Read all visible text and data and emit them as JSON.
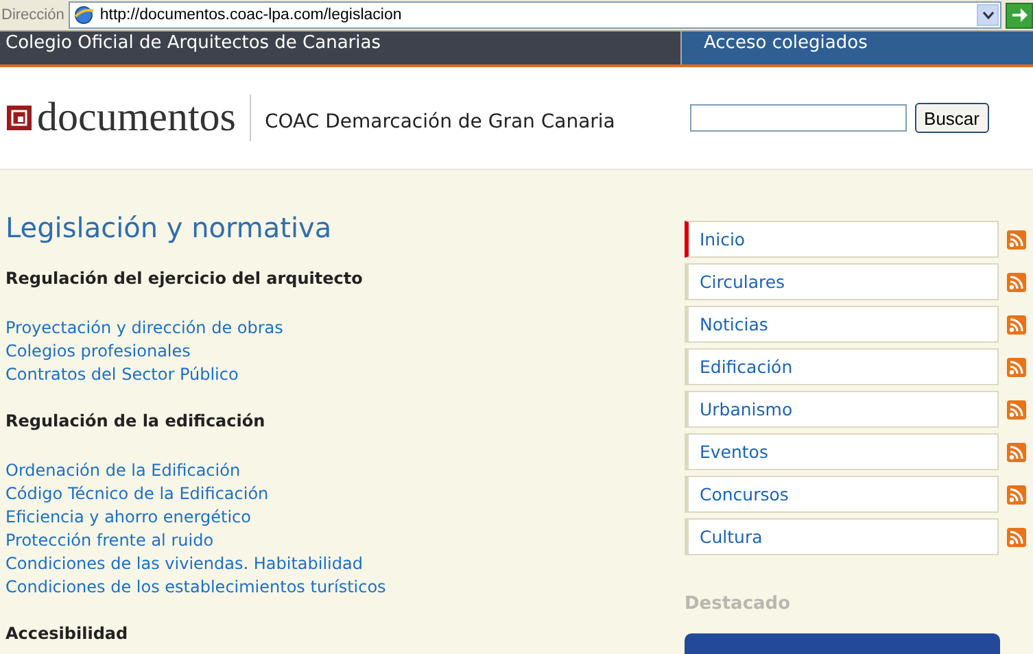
{
  "address_bar": {
    "label": "Dirección",
    "url": "http://documentos.coac-lpa.com/legislacion"
  },
  "top_bar": {
    "org": "Colegio Oficial de Arquitectos de Canarias",
    "login": "Acceso colegiados"
  },
  "header": {
    "logo": "documentos",
    "subtitle": "COAC Demarcación de Gran Canaria",
    "search_button": "Buscar"
  },
  "main": {
    "title": "Legislación y normativa",
    "items": [
      {
        "kind": "heading",
        "text": "Regulación del ejercicio del arquitecto"
      },
      {
        "kind": "link",
        "text": "Proyectación y dirección de obras"
      },
      {
        "kind": "link",
        "text": "Colegios profesionales"
      },
      {
        "kind": "link",
        "text": "Contratos del Sector Público"
      },
      {
        "kind": "heading",
        "text": "Regulación de la edificación"
      },
      {
        "kind": "link",
        "text": "Ordenación de la Edificación"
      },
      {
        "kind": "link",
        "text": "Código Técnico de la Edificación"
      },
      {
        "kind": "link",
        "text": "Eficiencia y ahorro energético"
      },
      {
        "kind": "link",
        "text": "Protección frente al ruido"
      },
      {
        "kind": "link",
        "text": "Condiciones de las viviendas. Habitabilidad"
      },
      {
        "kind": "link",
        "text": "Condiciones de los establecimientos turísticos"
      },
      {
        "kind": "heading",
        "text": "Accesibilidad"
      }
    ]
  },
  "sidebar": {
    "items": [
      {
        "label": "Inicio",
        "selected": true
      },
      {
        "label": "Circulares",
        "selected": false
      },
      {
        "label": "Noticias",
        "selected": false
      },
      {
        "label": "Edificación",
        "selected": false
      },
      {
        "label": "Urbanismo",
        "selected": false
      },
      {
        "label": "Eventos",
        "selected": false
      },
      {
        "label": "Concursos",
        "selected": false
      },
      {
        "label": "Cultura",
        "selected": false
      }
    ],
    "featured_heading": "Destacado"
  }
}
